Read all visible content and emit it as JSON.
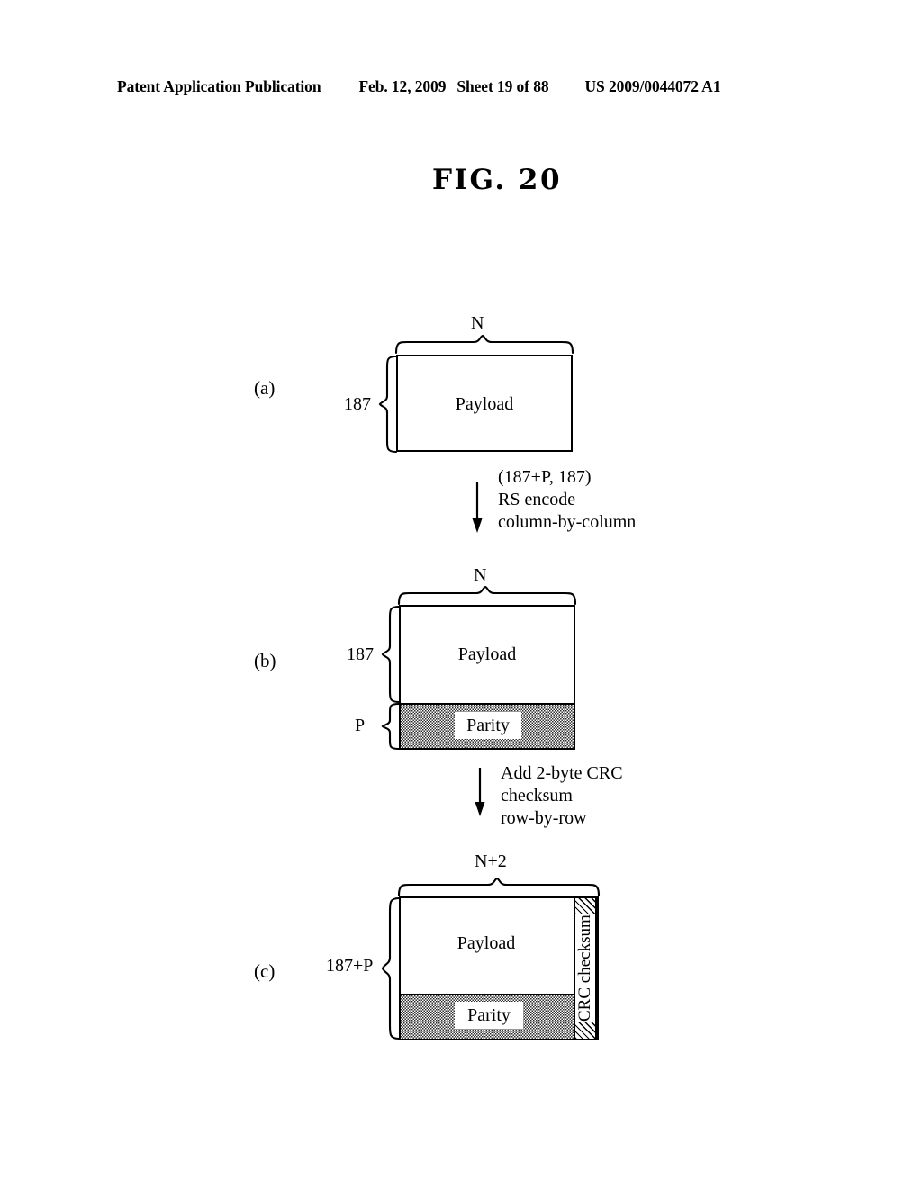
{
  "header": {
    "publication": "Patent Application Publication",
    "date": "Feb. 12, 2009",
    "sheet": "Sheet 19 of 88",
    "patent_number": "US 2009/0044072 A1"
  },
  "figure": {
    "title": "FIG. 20"
  },
  "panels": [
    {
      "letter": "(a)",
      "top_dim": "N",
      "left_dims": [
        "187"
      ],
      "cells": [
        "Payload"
      ]
    },
    {
      "letter": "(b)",
      "top_dim": "N",
      "left_dims": [
        "187",
        "P"
      ],
      "cells": [
        "Payload",
        "Parity"
      ]
    },
    {
      "letter": "(c)",
      "top_dim": "N+2",
      "left_dims": [
        "187+P"
      ],
      "cells": [
        "Payload",
        "Parity",
        "CRC checksum"
      ]
    }
  ],
  "transitions": [
    {
      "lines": [
        "(187+P, 187)",
        "RS encode",
        "column-by-column"
      ]
    },
    {
      "lines": [
        "Add 2-byte CRC",
        "checksum",
        "row-by-row"
      ]
    }
  ],
  "icons": {
    "down_arrow": "down-arrow-icon",
    "brace_top": "top-brace-icon",
    "brace_left": "left-brace-icon"
  }
}
